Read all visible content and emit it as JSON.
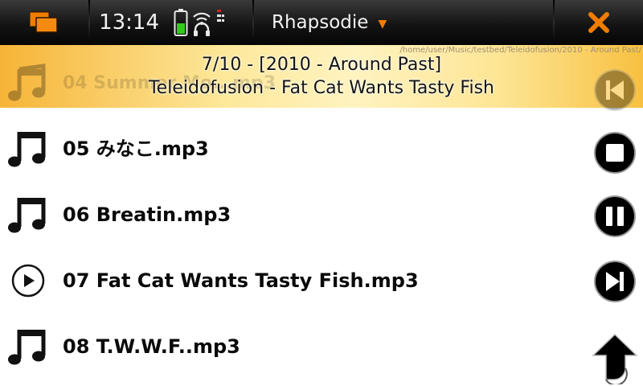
{
  "statusbar": {
    "time": "13:14",
    "app_title": "Rhapsodie",
    "icons": {
      "task_switcher": "task-switcher-icon",
      "battery": "battery-icon",
      "wifi": "wifi-icon",
      "headset": "headset-icon",
      "signal": "signal-icon",
      "menu": "dropdown-arrow-icon",
      "close": "close-icon"
    }
  },
  "now_playing": {
    "path": "/home/user/Music/testbed/Teleidofusion/2010 - Around Past/",
    "line1": "7/10 - [2010 - Around Past]",
    "line2": "Teleidofusion - Fat Cat Wants Tasty Fish",
    "hidden_item": "04 Summer Mo...mp3"
  },
  "playlist": [
    {
      "label": "05 みなこ.mp3",
      "icon": "music-note-icon"
    },
    {
      "label": "06 Breatin.mp3",
      "icon": "music-note-icon"
    },
    {
      "label": "07 Fat Cat Wants Tasty Fish.mp3",
      "icon": "play-circle-icon"
    },
    {
      "label": "08 T.W.W.F..mp3",
      "icon": "music-note-icon"
    }
  ],
  "controls": [
    "previous-icon",
    "stop-icon",
    "pause-icon",
    "next-icon",
    "back-icon"
  ],
  "colors": {
    "accent_orange": "#f07d00",
    "statusbar_bg": "#141414",
    "banner_gold": "#f6b437",
    "text_dark": "#0a0a0a"
  }
}
